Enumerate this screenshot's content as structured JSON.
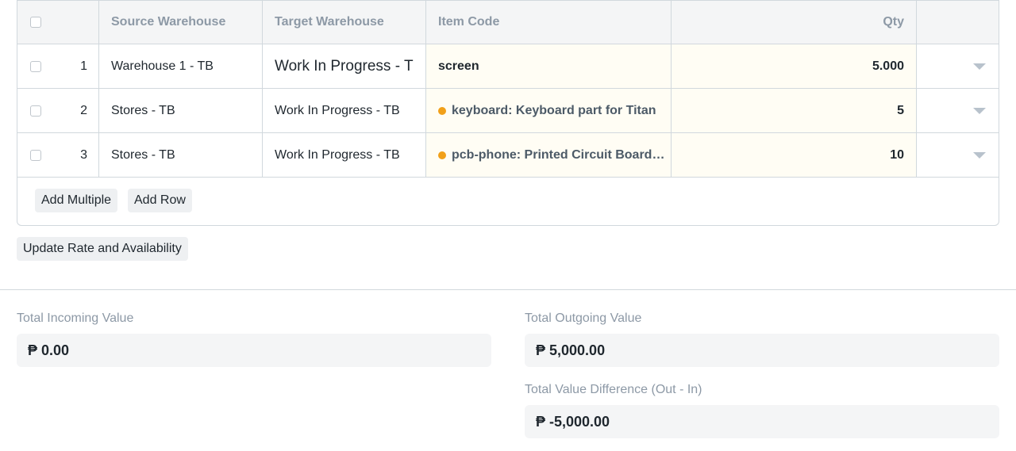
{
  "table": {
    "headers": {
      "source_warehouse": "Source Warehouse",
      "target_warehouse": "Target Warehouse",
      "item_code": "Item Code",
      "qty": "Qty"
    },
    "rows": [
      {
        "num": "1",
        "source": "Warehouse 1 - TB",
        "target": "Work In Progress - T",
        "item": "screen",
        "qty": "5.000"
      },
      {
        "num": "2",
        "source": "Stores - TB",
        "target": "Work In Progress - TB",
        "item": "keyboard: Keyboard part for Titan",
        "qty": "5"
      },
      {
        "num": "3",
        "source": "Stores - TB",
        "target": "Work In Progress - TB",
        "item": "pcb-phone: Printed Circuit Board…",
        "qty": "10"
      }
    ],
    "add_multiple_label": "Add Multiple",
    "add_row_label": "Add Row"
  },
  "update_rate_label": "Update Rate and Availability",
  "totals": {
    "incoming_label": "Total Incoming Value",
    "incoming_value": "₱ 0.00",
    "outgoing_label": "Total Outgoing Value",
    "outgoing_value": "₱ 5,000.00",
    "difference_label": "Total Value Difference (Out - In)",
    "difference_value": "₱ -5,000.00"
  },
  "colors": {
    "indicator": "#f1a019",
    "border": "#d1d8dd",
    "header_bg": "#f4f5f6"
  }
}
